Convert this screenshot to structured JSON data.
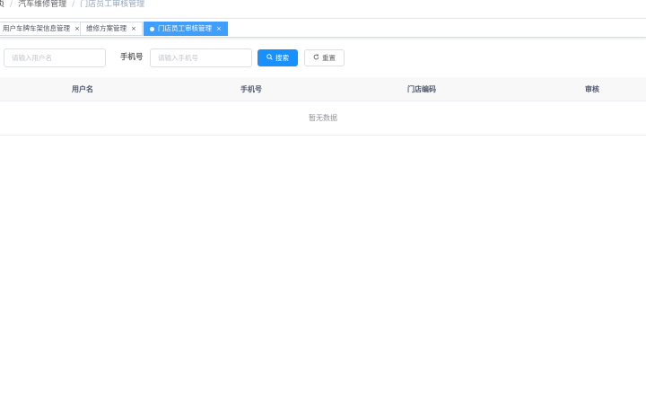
{
  "breadcrumb": {
    "home": "页",
    "items": [
      "汽车维修管理",
      "门店员工审核管理"
    ],
    "separator": "/"
  },
  "tags": [
    {
      "label": "用户车牌车架信息管理",
      "close": "×",
      "active": false
    },
    {
      "label": "维修方案管理",
      "close": "×",
      "active": false
    },
    {
      "label": "门店员工审核管理",
      "close": "×",
      "active": true
    }
  ],
  "search": {
    "username_placeholder": "请输入用户名",
    "username_value": "",
    "phone_label": "手机号",
    "phone_placeholder": "请输入手机号",
    "phone_value": "",
    "search_label": "搜索",
    "reset_label": "重置"
  },
  "table": {
    "columns": [
      "用户名",
      "手机号",
      "门店编码",
      "审核"
    ],
    "empty_text": "暂无数据"
  },
  "colors": {
    "primary": "#1890ff",
    "tag_active": "#409eff"
  }
}
